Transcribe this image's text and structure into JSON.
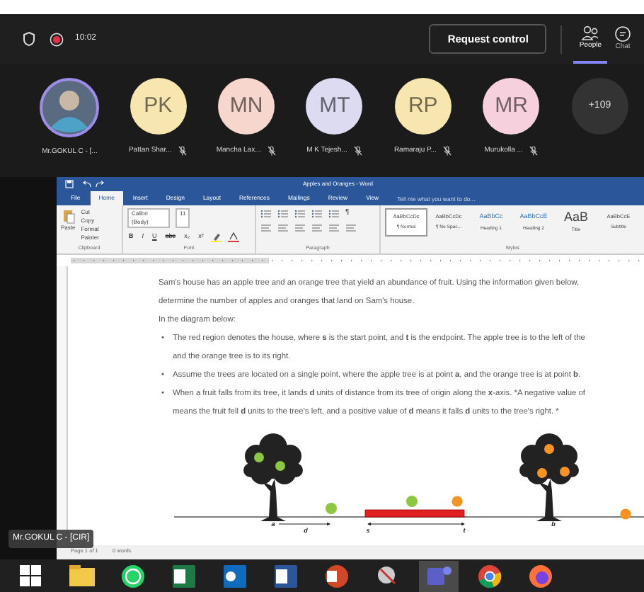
{
  "meeting_bar": {
    "time": "10:02",
    "recording": true,
    "request_button": "Request control",
    "tabs": [
      {
        "label": "People",
        "selected": true
      },
      {
        "label": "Chat",
        "selected": false
      }
    ]
  },
  "participants": [
    {
      "kind": "photo",
      "name": "Mr.GOKUL C - [...",
      "muted": false
    },
    {
      "kind": "initials",
      "initials": "PK",
      "name": "Pattan Shar...",
      "muted": true,
      "color": "#f8e6b0"
    },
    {
      "kind": "initials",
      "initials": "MN",
      "name": "Mancha Lax...",
      "muted": true,
      "color": "#f6d6cd"
    },
    {
      "kind": "initials",
      "initials": "MT",
      "name": "M K Tejesh...",
      "muted": true,
      "color": "#dcdbf2"
    },
    {
      "kind": "initials",
      "initials": "RP",
      "name": "Ramaraju P...",
      "muted": true,
      "color": "#f8e6b0"
    },
    {
      "kind": "initials",
      "initials": "MR",
      "name": "Murukolla ...",
      "muted": true,
      "color": "#f6d0dd"
    }
  ],
  "overflow_count": "+109",
  "word": {
    "title": "Apples and Oranges - Word",
    "tabs": [
      {
        "label": "File",
        "selected": false
      },
      {
        "label": "Home",
        "selected": true
      },
      {
        "label": "Insert",
        "selected": false
      },
      {
        "label": "Design",
        "selected": false
      },
      {
        "label": "Layout",
        "selected": false
      },
      {
        "label": "References",
        "selected": false
      },
      {
        "label": "Mailings",
        "selected": false
      },
      {
        "label": "Review",
        "selected": false
      },
      {
        "label": "View",
        "selected": false
      }
    ],
    "tell_me": "Tell me what you want to do...",
    "clipboard": {
      "paste": "Paste",
      "cut": "Cut",
      "copy": "Copy",
      "format_painter": "Format Painter",
      "label": "Clipboard"
    },
    "font": {
      "name": "Calibri (Body)",
      "size": "11",
      "buttons": [
        "B",
        "I",
        "U",
        "abc",
        "x₂",
        "x²"
      ],
      "label": "Font"
    },
    "paragraph": {
      "pilcrow": "¶",
      "label": "Paragraph"
    },
    "styles": {
      "label": "Styles",
      "items": [
        {
          "preview": "AaBbCcDc",
          "name": "¶ Normal",
          "selected": true
        },
        {
          "preview": "AaBbCcDc",
          "name": "¶ No Spac...",
          "selected": false
        },
        {
          "preview": "AaBbCc",
          "name": "Heading 1",
          "selected": false
        },
        {
          "preview": "AaBbCcE",
          "name": "Heading 2",
          "selected": false
        },
        {
          "preview": "AaB",
          "name": "Title",
          "selected": false
        },
        {
          "preview": "AaBbCcE",
          "name": "Subtitle",
          "selected": false
        }
      ]
    },
    "document": {
      "paragraphs": [
        "Sam's house has an apple tree and an orange tree that yield an abundance of fruit. Using the information given below, determine the number of apples and oranges that land on Sam's house.",
        "In the diagram below:"
      ],
      "bullets": [
        {
          "marker": "•",
          "lines": [
            "The red region denotes the house, where **s** is the start point, and **t** is the endpoint. The apple tree is to the left of the",
            "and the orange tree is to its right."
          ]
        },
        {
          "marker": "•",
          "lines": [
            "Assume the trees are located on a single point, where the apple tree is at point **a**, and the orange tree is at point **b**."
          ]
        },
        {
          "marker": "•",
          "lines": [
            "When a fruit falls from its tree, it lands **d** units of distance from its tree of origin along the **x**-axis. *A negative value of",
            "means the fruit fell **d** units to the tree's left, and a positive value of **d** means it falls **d** units to the tree's right. *"
          ]
        }
      ],
      "diagram_labels": {
        "a": "a",
        "d": "d",
        "s": "s",
        "t": "t",
        "b": "b"
      }
    },
    "status": [
      "Page 1 of 1",
      "0 words"
    ]
  },
  "presenter_label": "Mr.GOKUL C - [CIR]",
  "taskbar": [
    {
      "kind": "windows",
      "active": false
    },
    {
      "kind": "explorer",
      "active": false
    },
    {
      "kind": "whatsapp",
      "active": false
    },
    {
      "kind": "excel",
      "active": false
    },
    {
      "kind": "outlook",
      "active": false
    },
    {
      "kind": "word",
      "active": false
    },
    {
      "kind": "powerpoint",
      "active": false
    },
    {
      "kind": "satellite",
      "active": false
    },
    {
      "kind": "teams",
      "active": true
    },
    {
      "kind": "chrome",
      "active": false
    },
    {
      "kind": "firefox",
      "active": false
    }
  ]
}
